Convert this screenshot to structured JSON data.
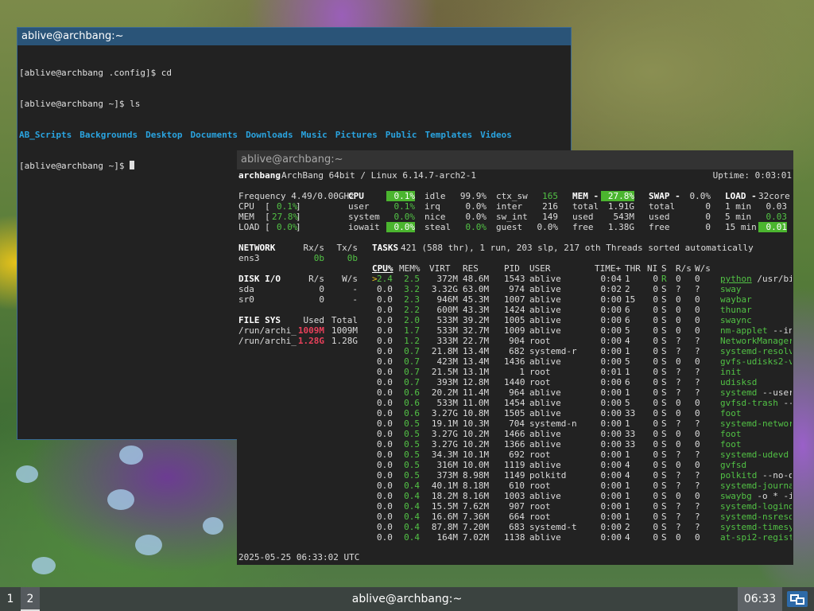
{
  "terminal1": {
    "title": "ablive@archbang:~",
    "lines": [
      "[ablive@archbang .config]$ cd",
      "[ablive@archbang ~]$ ls"
    ],
    "ls_items": [
      "AB_Scripts",
      "Backgrounds",
      "Desktop",
      "Documents",
      "Downloads",
      "Music",
      "Pictures",
      "Public",
      "Templates",
      "Videos"
    ],
    "prompt": "[ablive@archbang ~]$ "
  },
  "glances": {
    "title": "ablive@archbang:~",
    "header": {
      "host": "archbang",
      "os": "ArchBang 64bit / Linux 6.14.7-arch2-1",
      "uptime": "Uptime: 0:03:01"
    },
    "quicklook": {
      "frequency": "Frequency 4.49/0.00GHz",
      "cpu": "0.1%",
      "mem": "27.8%",
      "load": "0.0%"
    },
    "cpu": {
      "label": "CPU",
      "total": "0.1%",
      "user": "0.1%",
      "irq": "0.0%",
      "system": "0.0%",
      "nice": "0.0%",
      "iowait": "0.0%",
      "steal": "0.0%",
      "idle": "99.9%",
      "ctx_sw": "165",
      "inter": "216",
      "sw_int": "149",
      "guest": "0.0%"
    },
    "mem": {
      "label": "MEM",
      "pct": "27.8%",
      "total": "1.91G",
      "used": "543M",
      "free": "1.38G"
    },
    "swap": {
      "label": "SWAP",
      "pct": "0.0%",
      "total": "0",
      "used": "0",
      "free": "0"
    },
    "load": {
      "label": "LOAD",
      "cores": "32core",
      "m1": "0.03",
      "m5": "0.03",
      "m15": "0.01"
    },
    "network": {
      "label": "NETWORK",
      "rx_h": "Rx/s",
      "tx_h": "Tx/s",
      "iface": "ens3",
      "rx": "0b",
      "tx": "0b"
    },
    "disk": {
      "label": "DISK I/O",
      "r_h": "R/s",
      "w_h": "W/s",
      "rows": [
        [
          "sda",
          "0",
          "-"
        ],
        [
          "sr0",
          "0",
          "-"
        ]
      ]
    },
    "fs": {
      "label": "FILE SYS",
      "used_h": "Used",
      "total_h": "Total",
      "rows": [
        [
          "/run/archi_",
          "1009M",
          "1009M"
        ],
        [
          "/run/archi_",
          "1.28G",
          "1.28G"
        ]
      ]
    },
    "tasks": {
      "label": "TASKS",
      "summary": "421 (588 thr), 1 run, 203 slp, 217 oth Threads sorted automatically"
    },
    "proc_headers": [
      "CPU%",
      "MEM%",
      "VIRT",
      "RES",
      "PID",
      "USER",
      "TIME+",
      "THR",
      "NI",
      "S",
      "R/s",
      "W/s"
    ],
    "processes": [
      [
        "2.4",
        "2.5",
        "372M",
        "48.6M",
        "1543",
        "ablive",
        "0:04",
        "1",
        "0",
        "R",
        "0",
        "0",
        "python",
        "/usr/bin"
      ],
      [
        "0.0",
        "3.2",
        "3.32G",
        "63.0M",
        "974",
        "ablive",
        "0:02",
        "2",
        "0",
        "S",
        "?",
        "?",
        "sway",
        ""
      ],
      [
        "0.0",
        "2.3",
        "946M",
        "45.3M",
        "1007",
        "ablive",
        "0:00",
        "15",
        "0",
        "S",
        "0",
        "0",
        "waybar",
        ""
      ],
      [
        "0.0",
        "2.2",
        "600M",
        "43.3M",
        "1424",
        "ablive",
        "0:00",
        "6",
        "0",
        "S",
        "0",
        "0",
        "thunar",
        ""
      ],
      [
        "0.0",
        "2.0",
        "533M",
        "39.2M",
        "1005",
        "ablive",
        "0:00",
        "6",
        "0",
        "S",
        "0",
        "0",
        "swaync",
        ""
      ],
      [
        "0.0",
        "1.7",
        "533M",
        "32.7M",
        "1009",
        "ablive",
        "0:00",
        "5",
        "0",
        "S",
        "0",
        "0",
        "nm-applet",
        "--ind"
      ],
      [
        "0.0",
        "1.2",
        "333M",
        "22.7M",
        "904",
        "root",
        "0:00",
        "4",
        "0",
        "S",
        "?",
        "?",
        "NetworkManager",
        ""
      ],
      [
        "0.0",
        "0.7",
        "21.8M",
        "13.4M",
        "682",
        "systemd-r",
        "0:00",
        "1",
        "0",
        "S",
        "?",
        "?",
        "systemd-resolve",
        ""
      ],
      [
        "0.0",
        "0.7",
        "423M",
        "13.4M",
        "1436",
        "ablive",
        "0:00",
        "5",
        "0",
        "S",
        "0",
        "0",
        "gvfs-udisks2-vo",
        ""
      ],
      [
        "0.0",
        "0.7",
        "21.5M",
        "13.1M",
        "1",
        "root",
        "0:01",
        "1",
        "0",
        "S",
        "?",
        "?",
        "init",
        ""
      ],
      [
        "0.0",
        "0.7",
        "393M",
        "12.8M",
        "1440",
        "root",
        "0:00",
        "6",
        "0",
        "S",
        "?",
        "?",
        "udisksd",
        ""
      ],
      [
        "0.0",
        "0.6",
        "20.2M",
        "11.4M",
        "964",
        "ablive",
        "0:00",
        "1",
        "0",
        "S",
        "?",
        "?",
        "systemd",
        "--user"
      ],
      [
        "0.0",
        "0.6",
        "533M",
        "11.0M",
        "1454",
        "ablive",
        "0:00",
        "5",
        "0",
        "S",
        "0",
        "0",
        "gvfsd-trash",
        "--s"
      ],
      [
        "0.0",
        "0.6",
        "3.27G",
        "10.8M",
        "1505",
        "ablive",
        "0:00",
        "33",
        "0",
        "S",
        "0",
        "0",
        "foot",
        ""
      ],
      [
        "0.0",
        "0.5",
        "19.1M",
        "10.3M",
        "704",
        "systemd-n",
        "0:00",
        "1",
        "0",
        "S",
        "?",
        "?",
        "systemd-network",
        ""
      ],
      [
        "0.0",
        "0.5",
        "3.27G",
        "10.2M",
        "1466",
        "ablive",
        "0:00",
        "33",
        "0",
        "S",
        "0",
        "0",
        "foot",
        ""
      ],
      [
        "0.0",
        "0.5",
        "3.27G",
        "10.2M",
        "1366",
        "ablive",
        "0:00",
        "33",
        "0",
        "S",
        "0",
        "0",
        "foot",
        ""
      ],
      [
        "0.0",
        "0.5",
        "34.3M",
        "10.1M",
        "692",
        "root",
        "0:00",
        "1",
        "0",
        "S",
        "?",
        "?",
        "systemd-udevd",
        ""
      ],
      [
        "0.0",
        "0.5",
        "316M",
        "10.0M",
        "1119",
        "ablive",
        "0:00",
        "4",
        "0",
        "S",
        "0",
        "0",
        "gvfsd",
        ""
      ],
      [
        "0.0",
        "0.5",
        "373M",
        "8.98M",
        "1149",
        "polkitd",
        "0:00",
        "4",
        "0",
        "S",
        "?",
        "?",
        "polkitd",
        "--no-de"
      ],
      [
        "0.0",
        "0.4",
        "40.1M",
        "8.18M",
        "610",
        "root",
        "0:00",
        "1",
        "0",
        "S",
        "?",
        "?",
        "systemd-journal",
        ""
      ],
      [
        "0.0",
        "0.4",
        "18.2M",
        "8.16M",
        "1003",
        "ablive",
        "0:00",
        "1",
        "0",
        "S",
        "0",
        "0",
        "swaybg",
        "-o * -i"
      ],
      [
        "0.0",
        "0.4",
        "15.5M",
        "7.62M",
        "907",
        "root",
        "0:00",
        "1",
        "0",
        "S",
        "?",
        "?",
        "systemd-logind",
        ""
      ],
      [
        "0.0",
        "0.4",
        "16.6M",
        "7.36M",
        "664",
        "root",
        "0:00",
        "1",
        "0",
        "S",
        "?",
        "?",
        "systemd-nsresou",
        ""
      ],
      [
        "0.0",
        "0.4",
        "87.8M",
        "7.20M",
        "683",
        "systemd-t",
        "0:00",
        "2",
        "0",
        "S",
        "?",
        "?",
        "systemd-timesyn",
        ""
      ],
      [
        "0.0",
        "0.4",
        "164M",
        "7.02M",
        "1138",
        "ablive",
        "0:00",
        "4",
        "0",
        "S",
        "0",
        "0",
        "at-spi2-registr",
        ""
      ]
    ],
    "footer": "2025-05-25 06:33:02 UTC"
  },
  "taskbar": {
    "workspaces": [
      "1",
      "2"
    ],
    "active_workspace": "2",
    "title": "ablive@archbang:~",
    "clock": "06:33"
  },
  "colors": {
    "accent_title": "#2a5478",
    "bar_green": "#4bb52f",
    "ls_blue": "#2aa4e0",
    "alert_red": "#e8405a"
  }
}
